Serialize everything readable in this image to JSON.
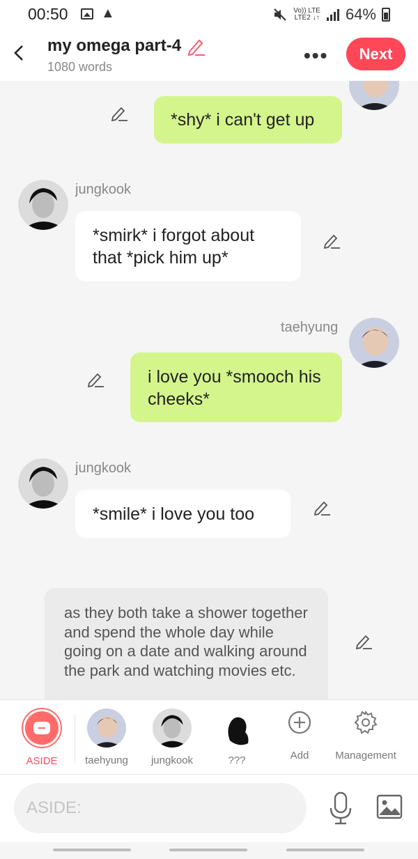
{
  "status_bar": {
    "time": "00:50",
    "network_top": "Vo)) LTE",
    "network_bottom": "LTE2 ↓↑",
    "battery": "64%"
  },
  "header": {
    "title": "my omega part-4",
    "word_count": "1080 words",
    "more": "•••",
    "next_label": "Next"
  },
  "messages": [
    {
      "speaker": "",
      "side": "right",
      "text": "*shy* i can't get up"
    },
    {
      "speaker": "jungkook",
      "side": "left",
      "text": "*smirk* i forgot about that *pick him up*"
    },
    {
      "speaker": "taehyung",
      "side": "right",
      "text": "i love you *smooch his cheeks*"
    },
    {
      "speaker": "jungkook",
      "side": "left",
      "text": "*smile*  i love you too"
    }
  ],
  "narration": "as they both take a shower together and spend the whole day while going on a date and walking around the park and watching movies etc.",
  "character_bar": {
    "aside": "ASIDE",
    "characters": [
      "taehyung",
      "jungkook",
      "???"
    ],
    "add": "Add",
    "management": "Management"
  },
  "input": {
    "placeholder": "ASIDE:"
  },
  "colors": {
    "accent": "#ff4757",
    "right_bubble": "#d4f58c",
    "left_bubble": "#ffffff"
  }
}
